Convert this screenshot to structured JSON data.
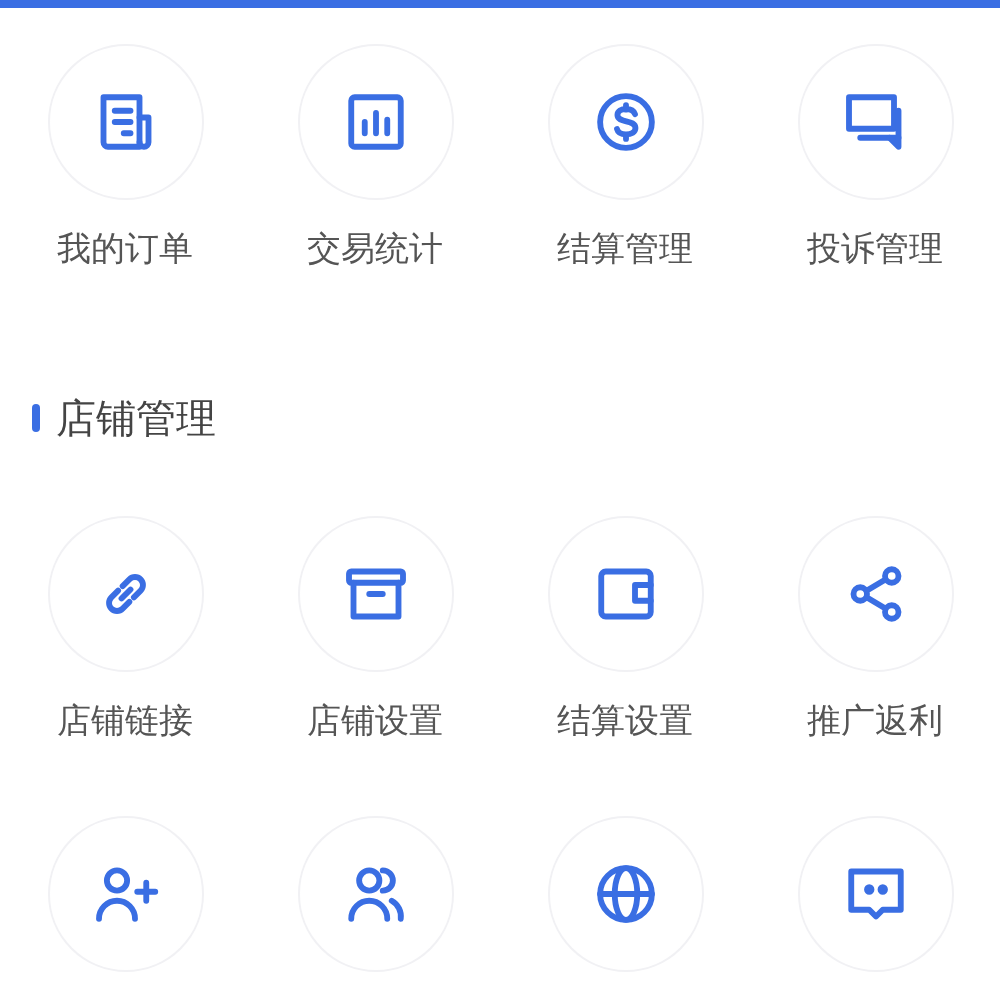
{
  "sections": [
    {
      "items": [
        {
          "kind": "labeled",
          "label": "我的订单"
        },
        {
          "kind": "labeled",
          "label": "交易统计"
        },
        {
          "kind": "labeled",
          "label": "结算管理"
        },
        {
          "kind": "labeled",
          "label": "投诉管理"
        }
      ]
    },
    {
      "title": "店铺管理",
      "items": [
        {
          "kind": "labeled",
          "label": "店铺链接"
        },
        {
          "kind": "labeled",
          "label": "店铺设置"
        },
        {
          "kind": "labeled",
          "label": "结算设置"
        },
        {
          "kind": "labeled",
          "label": "推广返利"
        },
        {
          "kind": "icon_only"
        },
        {
          "kind": "icon_only"
        },
        {
          "kind": "icon_only"
        },
        {
          "kind": "icon_only"
        }
      ]
    }
  ]
}
